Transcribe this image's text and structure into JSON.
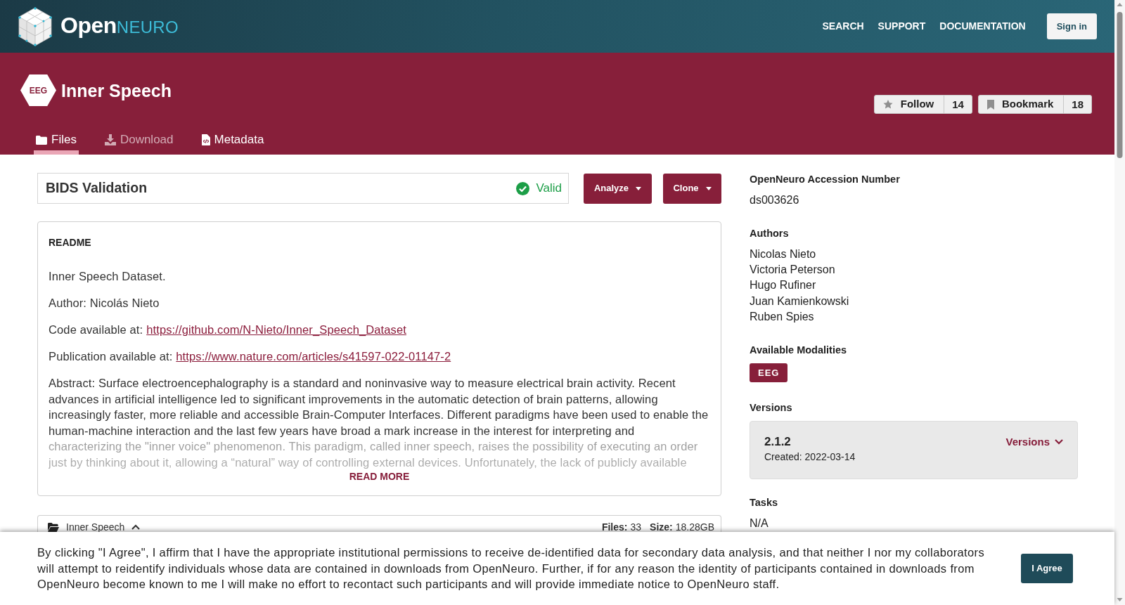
{
  "navbar": {
    "logo": {
      "primary": "Open",
      "secondary": "NEURO"
    },
    "links": [
      "SEARCH",
      "SUPPORT",
      "DOCUMENTATION"
    ],
    "sign_in": "Sign in"
  },
  "dataset_header": {
    "modality": "EEG",
    "title": "Inner Speech",
    "actions": [
      {
        "kind": "follow",
        "label": "Follow",
        "count": "14"
      },
      {
        "kind": "bookmark",
        "label": "Bookmark",
        "count": "18"
      }
    ],
    "tabs": [
      {
        "kind": "files",
        "label": "Files",
        "selected": true,
        "disabled": false
      },
      {
        "kind": "download",
        "label": "Download",
        "selected": false,
        "disabled": true
      },
      {
        "kind": "metadata",
        "label": "Metadata",
        "selected": false,
        "disabled": false
      }
    ]
  },
  "validation": {
    "title": "BIDS Validation",
    "status": "Valid",
    "valid": true
  },
  "toolbar_buttons": [
    {
      "label": "Analyze"
    },
    {
      "label": "Clone"
    }
  ],
  "readme": {
    "heading": "README",
    "collapsed": true,
    "paragraphs": [
      {
        "kind": "text",
        "text": "Inner Speech Dataset."
      },
      {
        "kind": "text",
        "text": "Author: Nicolás Nieto"
      },
      {
        "kind": "link",
        "text": "Code available at:",
        "link": "https://github.com/N-Nieto/Inner_Speech_Dataset"
      },
      {
        "kind": "link",
        "text": "Publication available at:",
        "link": "https://www.nature.com/articles/s41597-022-01147-2"
      },
      {
        "kind": "text",
        "text": "Abstract: Surface electroencephalography is a standard and noninvasive way to measure electrical brain activity. Recent advances in artificial intelligence led to significant improvements in the automatic detection of brain patterns, allowing increasingly faster, more reliable and accessible Brain-Computer Interfaces. Different paradigms have been used to enable the human-machine interaction and the last few years have broad a mark increase in the interest for interpreting and characterizing the \"inner voice\" phenomenon. This paradigm, called inner speech, raises the possibility of executing an order just by thinking about it, allowing a “natural” way of controlling external devices. Unfortunately, the lack of publicly available"
      }
    ],
    "read_more": "READ MORE"
  },
  "files_bar": {
    "name": "Inner Speech",
    "expanded": true,
    "files_label": "Files:",
    "files": "33",
    "size_label": "Size:",
    "size": "18.28GB"
  },
  "sidebar": {
    "sections": [
      {
        "kind": "text",
        "heading": "OpenNeuro Accession Number",
        "value": "ds003626"
      },
      {
        "kind": "list",
        "heading": "Authors",
        "items": [
          "Nicolas Nieto",
          "Victoria Peterson",
          "Hugo Rufiner",
          "Juan Kamienkowski",
          "Ruben Spies"
        ]
      },
      {
        "kind": "badges",
        "heading": "Available Modalities",
        "items": [
          "EEG"
        ]
      },
      {
        "kind": "versions",
        "heading": "Versions",
        "version": "2.1.2",
        "created": "Created: 2022-03-14",
        "menu": "Versions"
      },
      {
        "kind": "text",
        "heading": "Tasks",
        "value": "N/A"
      }
    ]
  },
  "consent_banner": {
    "text": "By clicking \"I Agree\", I affirm that I have the appropriate institutional permissions to receive de-identified data for secondary data analysis, and that neither I nor my collaborators will attempt to reidentify individuals whose data are contained in downloads from OpenNeuro. Further, if for any reason the identity of participants contained in downloads from OpenNeuro become known to me I will make no effort to recontact such participants and will provide immediate notice to OpenNeuro staff.",
    "button": "I Agree"
  }
}
